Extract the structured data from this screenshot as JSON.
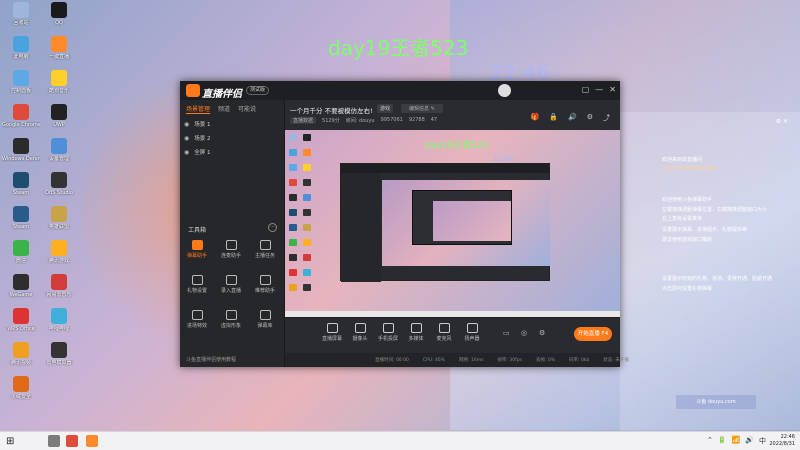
{
  "desktop": {
    "icons": [
      {
        "label": "回收站",
        "color": "#9fb5d9"
      },
      {
        "label": "QQ",
        "color": "#1a1a1a"
      },
      {
        "label": "此电脑",
        "color": "#4aa3df"
      },
      {
        "label": "一键直播",
        "color": "#ff8a2a"
      },
      {
        "label": "控制面板",
        "color": "#5fa8e6"
      },
      {
        "label": "酷狗音乐",
        "color": "#ffd02a"
      },
      {
        "label": "Google Chrome",
        "color": "#e04a3a"
      },
      {
        "label": "UWP",
        "color": "#222222"
      },
      {
        "label": "Windows Defender",
        "color": "#2b2b2b"
      },
      {
        "label": "设备管理",
        "color": "#4f8fd8"
      },
      {
        "label": "Steam",
        "color": "#1d4d6f"
      },
      {
        "label": "OBS Studio",
        "color": "#333333"
      },
      {
        "label": "Steam",
        "color": "#2a5c8a"
      },
      {
        "label": "英雄联盟",
        "color": "#c9a34a"
      },
      {
        "label": "微信",
        "color": "#3cb34a"
      },
      {
        "label": "腾讯游戏",
        "color": "#ffb020"
      },
      {
        "label": "WeGame",
        "color": "#2e2e2e"
      },
      {
        "label": "网易云音乐",
        "color": "#d43c3c"
      },
      {
        "label": "WPS Office",
        "color": "#d33"
      },
      {
        "label": "哔哩哔哩",
        "color": "#3fb0d9"
      },
      {
        "label": "腾讯视频",
        "color": "#f0a020"
      },
      {
        "label": "雷电模拟器",
        "color": "#333333"
      },
      {
        "label": "火绒安全",
        "color": "#e06a1a"
      }
    ],
    "overlay_title": "day19王者523",
    "overlay_clock": "22:46",
    "chat_lines": [
      {
        "text": "欢迎来到本直播间",
        "color": "#ffffff"
      },
      {
        "text": "牛仔3   欢迎来到本直播间",
        "color": "#ffd0a0"
      },
      {
        "text": "欢迎使用斗鱼弹幕助手",
        "color": "#ffffff"
      },
      {
        "text": "左键拖拽调整弹幕位置，右键拖拽调整窗口大小",
        "color": "#ffffff"
      },
      {
        "text": "右上角有设置菜单",
        "color": "#ffffff"
      },
      {
        "text": "设置展示弹幕、进场提示、礼物提示等",
        "color": "#ffffff"
      },
      {
        "text": "建议使用游戏窗口捕获",
        "color": "#ffffff"
      },
      {
        "text": "设置展示收到的礼物、进场、贵族开通、贴纸开通",
        "color": "#ffffff"
      },
      {
        "text": "点击即可设置礼物弹幕",
        "color": "#ffffff"
      }
    ],
    "chat_header": "⚙ ✕",
    "watermark": "斗鱼 douyu.com"
  },
  "app": {
    "logo_text": "直播伴侣",
    "version_badge": "测试版",
    "tabs": [
      "场景管理",
      "频道",
      "可能说"
    ],
    "scenes": [
      {
        "name": "场景 1",
        "icon": "◉"
      },
      {
        "name": "场景 2",
        "icon": "◉"
      },
      {
        "name": "全屏 1",
        "icon": "◉"
      }
    ],
    "tools_title": "工具箱",
    "tools_more": "···",
    "tools": [
      {
        "label": "弹幕助手",
        "hot": true
      },
      {
        "label": "连麦助手",
        "hot": false
      },
      {
        "label": "主播任务",
        "hot": false
      },
      {
        "label": "礼物设置",
        "hot": false
      },
      {
        "label": "录入直播",
        "hot": false
      },
      {
        "label": "推荐助手",
        "hot": false
      },
      {
        "label": "进场特效",
        "hot": false
      },
      {
        "label": "虚拟形象",
        "hot": false
      },
      {
        "label": "弹幕库",
        "hot": false
      }
    ],
    "left_bottom": "斗鱼直播伴侣使用教程",
    "room": {
      "title": "一个月千分 不要被模仿左右!",
      "category": "游戏",
      "edit_label": "编辑信息 ✎",
      "stats": [
        "直播数据",
        "5129分",
        "房间: douyu",
        "9957061",
        "92788",
        "47"
      ]
    },
    "top_right_icons": [
      "🎁",
      "🔒",
      "🔊",
      "⚙",
      "⤴"
    ],
    "controls": [
      {
        "label": "直播屏幕"
      },
      {
        "label": "摄像头"
      },
      {
        "label": "手机投屏"
      },
      {
        "label": "多媒体"
      },
      {
        "label": "麦克风"
      },
      {
        "label": "扬声器"
      }
    ],
    "live_button": "开始直播 F4",
    "status": [
      "直播时间: 00:00",
      "CPU: 46%",
      "网络: 16ms",
      "帧率: 30fps",
      "丢帧: 0%",
      "码率: 0kb",
      "状态: 未开播"
    ],
    "title_icons": [
      "▢",
      "—",
      "✕"
    ]
  },
  "taskbar": {
    "start": "⊞",
    "apps": [
      {
        "color": "#7b7b7b"
      },
      {
        "color": "#e04a3a"
      },
      {
        "color": "#ff8a2a"
      }
    ],
    "tray": [
      "⌃",
      "🔋",
      "📶",
      "🔊",
      "中"
    ],
    "time": "22:46",
    "date": "2022/8/31"
  }
}
